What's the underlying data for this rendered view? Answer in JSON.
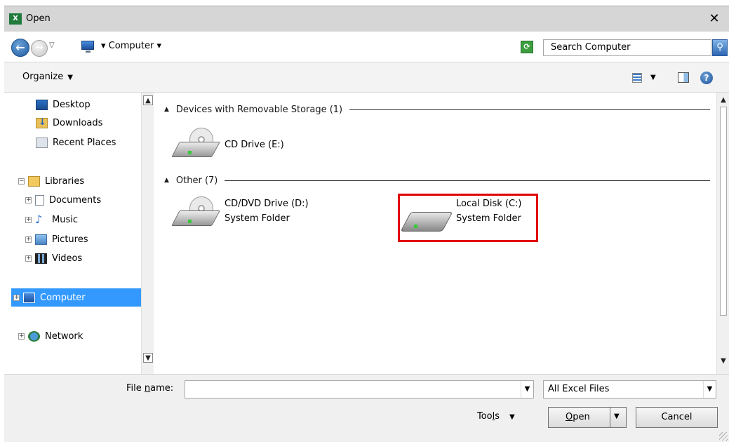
{
  "window": {
    "title": "Open",
    "app_icon": "X",
    "close_label": "✕"
  },
  "address": {
    "path": "Computer",
    "search_placeholder": "Search Computer"
  },
  "toolbar": {
    "organize_label": "Organize"
  },
  "nav": {
    "favorites": [
      {
        "label": "Desktop",
        "icon": "desktop-icon"
      },
      {
        "label": "Downloads",
        "icon": "downloads-icon"
      },
      {
        "label": "Recent Places",
        "icon": "recent-places-icon"
      }
    ],
    "libraries": {
      "label": "Libraries",
      "items": [
        {
          "label": "Documents"
        },
        {
          "label": "Music"
        },
        {
          "label": "Pictures"
        },
        {
          "label": "Videos"
        }
      ]
    },
    "computer": "Computer",
    "network": "Network"
  },
  "content": {
    "groups": [
      {
        "title": "Devices with Removable Storage (1)",
        "items": [
          {
            "name": "CD Drive (E:)",
            "subtitle": ""
          }
        ]
      },
      {
        "title": "Other (7)",
        "items": [
          {
            "name": "CD/DVD Drive (D:)",
            "subtitle": "System Folder"
          },
          {
            "name": "Local Disk (C:)",
            "subtitle": "System Folder"
          }
        ]
      }
    ],
    "highlight_color": "#e00000"
  },
  "bottom": {
    "filename_label_pre": "File ",
    "filename_label_underline": "n",
    "filename_label_post": "ame:",
    "filename_value": "",
    "filter": "All Excel Files",
    "tools_pre": "Too",
    "tools_underline": "l",
    "tools_post": "s",
    "open_underline": "O",
    "open_post": "pen",
    "cancel_label": "Cancel"
  },
  "colors": {
    "selection": "#3399ff",
    "accent": "#1e5aa0"
  }
}
